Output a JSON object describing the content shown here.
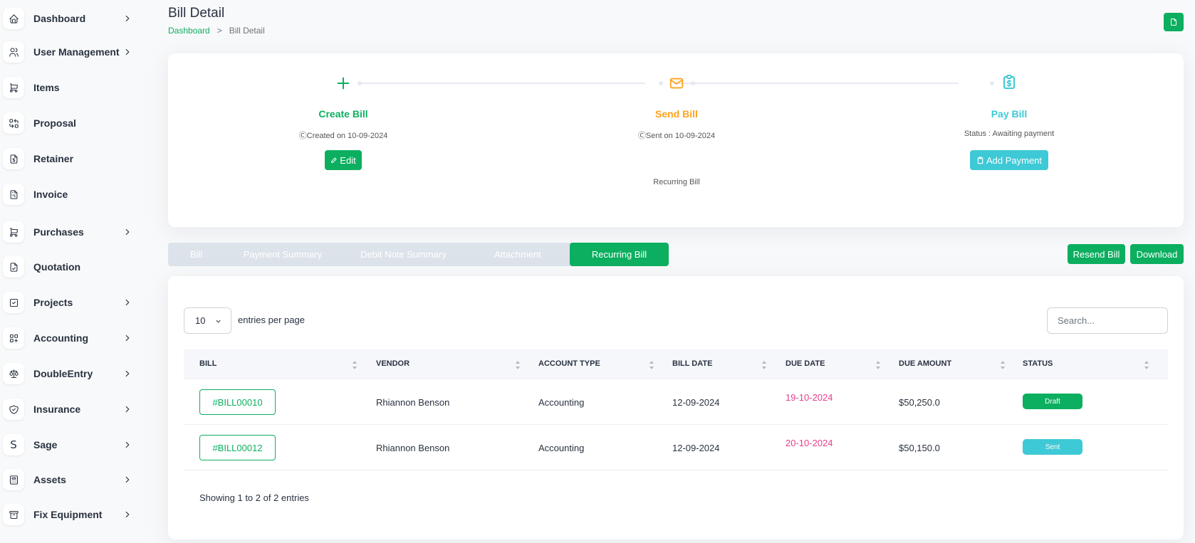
{
  "sidebar": {
    "items": [
      {
        "label": "Dashboard",
        "icon": "home-icon",
        "chevron": true
      },
      {
        "label": "User Management",
        "icon": "users-icon",
        "chevron": true
      },
      {
        "label": "Items",
        "icon": "cart-icon",
        "chevron": false
      },
      {
        "label": "Proposal",
        "icon": "replace-icon",
        "chevron": false
      },
      {
        "label": "Retainer",
        "icon": "file-dollar-icon",
        "chevron": false
      },
      {
        "label": "Invoice",
        "icon": "file-invoice-icon",
        "chevron": false
      },
      {
        "label": "Purchases",
        "icon": "shopping-cart-icon",
        "chevron": true
      },
      {
        "label": "Quotation",
        "icon": "file-check-icon",
        "chevron": false
      },
      {
        "label": "Projects",
        "icon": "square-check-icon",
        "chevron": true
      },
      {
        "label": "Accounting",
        "icon": "layout-grid-add-icon",
        "chevron": true
      },
      {
        "label": "DoubleEntry",
        "icon": "scale-icon",
        "chevron": true
      },
      {
        "label": "Insurance",
        "icon": "shield-check-icon",
        "chevron": true
      },
      {
        "label": "Sage",
        "icon": "letter-s-icon",
        "glyph": "S",
        "chevron": true
      },
      {
        "label": "Assets",
        "icon": "calculator-icon",
        "chevron": true
      },
      {
        "label": "Fix Equipment",
        "icon": "archive-icon",
        "chevron": true
      }
    ]
  },
  "header": {
    "title": "Bill Detail",
    "breadcrumb": {
      "home": "Dashboard",
      "separator": ">",
      "current": "Bill Detail"
    }
  },
  "steps": {
    "create": {
      "title": "Create Bill",
      "subtitle": "ⒸCreated on 10-09-2024",
      "button": "Edit",
      "color": "#0caf60"
    },
    "send": {
      "title": "Send Bill",
      "subtitle": "ⒸSent on 10-09-2024",
      "note": "Recurring Bill",
      "color": "#ffa21d"
    },
    "pay": {
      "title": "Pay Bill",
      "subtitle": "Status : Awaiting payment",
      "button": "Add Payment",
      "color": "#3ec9d6"
    }
  },
  "tabs": [
    {
      "label": "Bill",
      "active": false
    },
    {
      "label": "Payment Summary",
      "active": false
    },
    {
      "label": "Debit Note Summary",
      "active": false
    },
    {
      "label": "Attachment",
      "active": false
    },
    {
      "label": "Recurring Bill",
      "active": true
    }
  ],
  "actions": {
    "resend": "Resend Bill",
    "download": "Download"
  },
  "table": {
    "entries_value": "10",
    "entries_label": "entries per page",
    "search_placeholder": "Search...",
    "columns": [
      "BILL",
      "VENDOR",
      "ACCOUNT TYPE",
      "BILL DATE",
      "DUE DATE",
      "DUE AMOUNT",
      "STATUS"
    ],
    "rows": [
      {
        "bill": "#BILL00010",
        "vendor": "Rhiannon Benson",
        "account_type": "Accounting",
        "bill_date": "12-09-2024",
        "due_date": "19-10-2024",
        "due_amount": "$50,250.0",
        "status": "Draft",
        "status_color": "#0caf60"
      },
      {
        "bill": "#BILL00012",
        "vendor": "Rhiannon Benson",
        "account_type": "Accounting",
        "bill_date": "12-09-2024",
        "due_date": "20-10-2024",
        "due_amount": "$50,150.0",
        "status": "Sent",
        "status_color": "#3ec9d6"
      }
    ],
    "footer": "Showing 1 to 2 of 2 entries"
  },
  "colors": {
    "primary": "#0caf60",
    "warning": "#ffa21d",
    "info": "#3ec9d6",
    "danger": "#e83e8c"
  }
}
